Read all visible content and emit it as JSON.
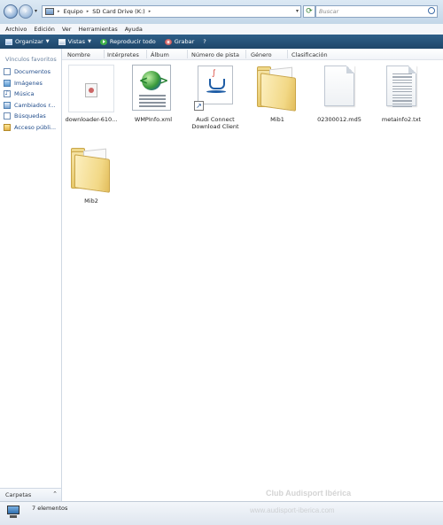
{
  "address_bar": {
    "crumbs": [
      "Equipo",
      "SD Card Drive (K:)"
    ],
    "search_placeholder": "Buscar"
  },
  "menu": [
    "Archivo",
    "Edición",
    "Ver",
    "Herramientas",
    "Ayuda"
  ],
  "toolbar": {
    "organize": "Organizar",
    "views": "Vistas",
    "play_all": "Reproducir todo",
    "burn": "Grabar"
  },
  "sidebar": {
    "title": "Vínculos favoritos",
    "items": [
      {
        "label": "Documentos",
        "icon": "documents-icon"
      },
      {
        "label": "Imágenes",
        "icon": "pictures-icon"
      },
      {
        "label": "Música",
        "icon": "music-icon"
      },
      {
        "label": "Cambiados r...",
        "icon": "recently-changed-icon"
      },
      {
        "label": "Búsquedas",
        "icon": "searches-icon"
      },
      {
        "label": "Acceso públi...",
        "icon": "public-icon"
      }
    ],
    "folders_label": "Carpetas"
  },
  "columns": [
    "Nombre",
    "Intérpretes",
    "Álbum",
    "Número de pista",
    "Género",
    "Clasificación"
  ],
  "files": [
    {
      "name": "downloader-610...",
      "icon": "jar-file-icon"
    },
    {
      "name": "WMPInfo.xml",
      "icon": "xml-file-icon"
    },
    {
      "name": "Audi Connect Download Client",
      "icon": "java-shortcut-icon"
    },
    {
      "name": "Mib1",
      "icon": "folder-icon"
    },
    {
      "name": "02300012.md5",
      "icon": "generic-file-icon"
    },
    {
      "name": "metainfo2.txt",
      "icon": "text-file-icon"
    },
    {
      "name": "Mib2",
      "icon": "folder-icon"
    }
  ],
  "status": {
    "count": "7 elementos"
  },
  "watermark": {
    "line1": "Club Audisport Ibérica",
    "line2": "www.audisport-iberica.com"
  }
}
